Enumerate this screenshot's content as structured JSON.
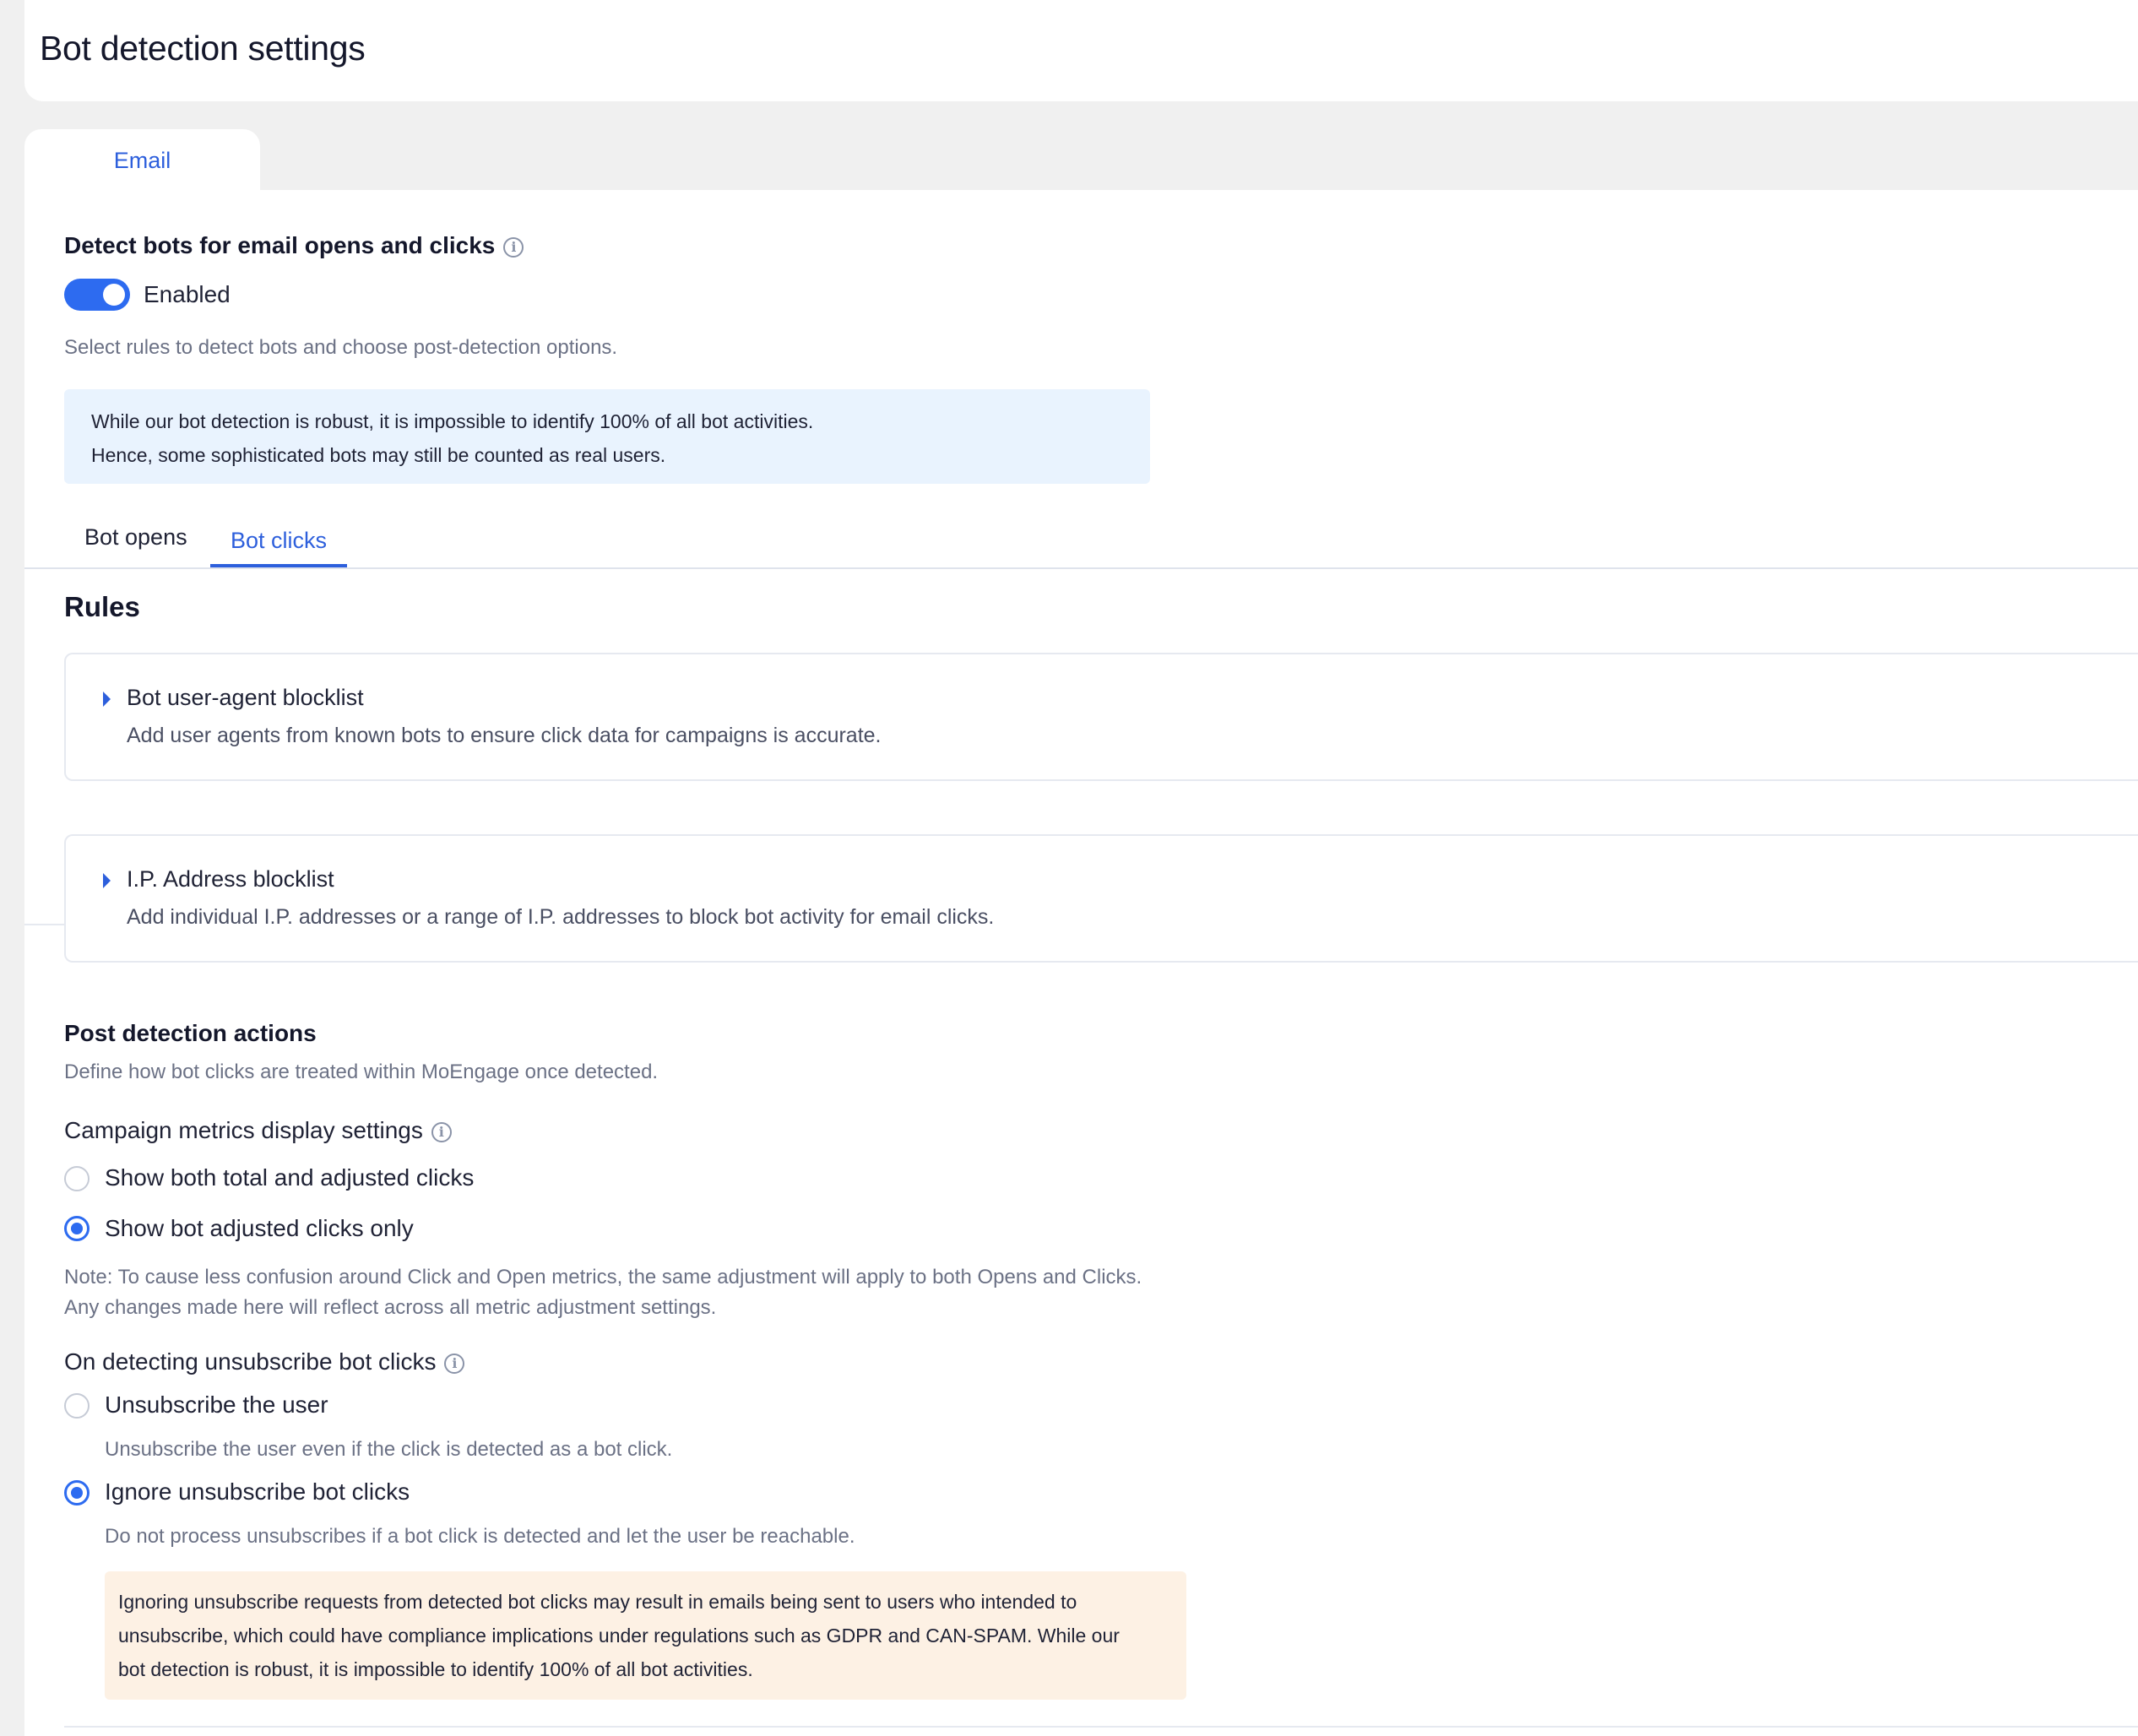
{
  "page": {
    "title": "Bot detection settings"
  },
  "channel_tabs": [
    {
      "label": "Email",
      "active": true
    }
  ],
  "detect": {
    "title": "Detect bots for email opens and clicks",
    "toggle_state_label": "Enabled",
    "toggle_on": true,
    "description": "Select rules to detect bots and choose post-detection options.",
    "info_box_line1": "While our bot detection is robust, it is impossible to identify 100% of all bot activities.",
    "info_box_line2": "Hence, some sophisticated bots may still be counted as real users."
  },
  "sub_tabs": [
    {
      "label": "Bot opens",
      "active": false
    },
    {
      "label": "Bot clicks",
      "active": true
    }
  ],
  "rules": {
    "heading": "Rules",
    "items": [
      {
        "title": "Bot user-agent blocklist",
        "description": "Add user agents from known bots to ensure click data for campaigns is accurate."
      },
      {
        "title": "I.P. Address blocklist",
        "description": "Add individual I.P. addresses or a range of I.P. addresses to block bot activity for email clicks."
      }
    ]
  },
  "post_detection": {
    "heading": "Post detection actions",
    "description": "Define how bot clicks are treated within MoEngage once detected.",
    "metrics_label": "Campaign metrics display settings",
    "metrics_options": [
      {
        "label": "Show both total and adjusted clicks",
        "selected": false
      },
      {
        "label": "Show bot adjusted clicks only",
        "selected": true
      }
    ],
    "note_line1": "Note: To cause less confusion around Click and Open metrics, the same adjustment will apply to both Opens and Clicks.",
    "note_line2": "Any changes made here will reflect across all metric adjustment settings.",
    "unsubscribe_label": "On detecting unsubscribe bot clicks",
    "unsubscribe_options": [
      {
        "label": "Unsubscribe the user",
        "description": "Unsubscribe the user even if the click is detected as a bot click.",
        "selected": false
      },
      {
        "label": "Ignore unsubscribe bot clicks",
        "description": "Do not process unsubscribes if a bot click is detected and let the user be reachable.",
        "selected": true
      }
    ],
    "warning_line1": "Ignoring unsubscribe requests from detected bot clicks may result in emails being sent to users who intended to",
    "warning_line2": "unsubscribe, which could have compliance implications under regulations such as GDPR and CAN-SPAM. While our",
    "warning_line3": "bot detection is robust, it is impossible to identify 100% of all bot activities."
  },
  "colors": {
    "accent": "#2d6bf0",
    "info_bg": "#e9f3fe",
    "warning_bg": "#fdf1e4",
    "page_bg": "#f0f0f0"
  }
}
